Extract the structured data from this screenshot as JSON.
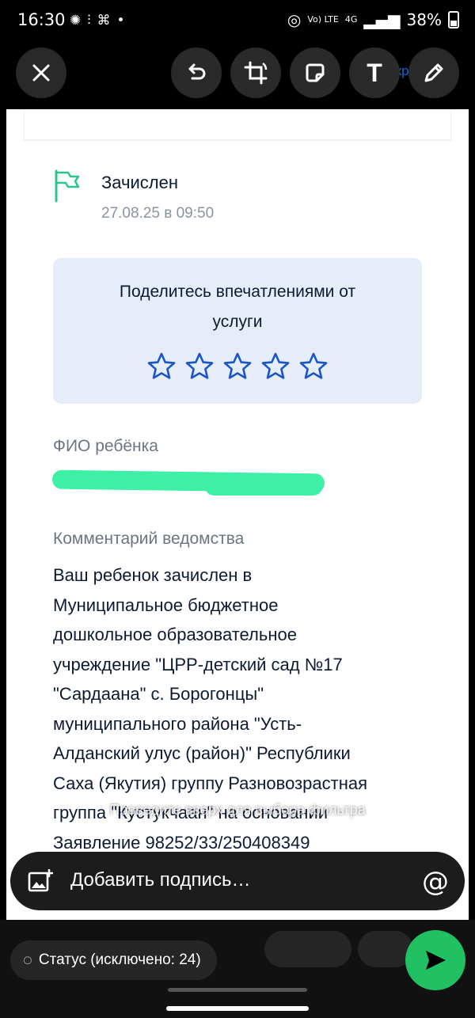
{
  "status_bar": {
    "time": "16:30",
    "notification_icons": [
      "fan-icon",
      "audio-icon",
      "shop-icon",
      "dot-icon"
    ],
    "network_volte": "Vo) LTE",
    "network_4g": "4G",
    "battery": "38%"
  },
  "toolbar": {
    "close": "close-icon",
    "undo": "undo-icon",
    "crop_rotate": "crop-rotate-icon",
    "sticker": "sticker-icon",
    "text_tool": "T",
    "draw": "pencil-icon",
    "behind_link": "Закрыть"
  },
  "screenshot": {
    "status_title": "Зачислен",
    "status_date": "27.08.25 в 09:50",
    "rating_prompt_line1": "Поделитесь впечатлениями от",
    "rating_prompt_line2": "услуги",
    "stars_total": 5,
    "child_name_label": "ФИО ребёнка",
    "comment_label": "Комментарий ведомства",
    "comment_text": "Ваш ребенок зачислен в\nМуниципальное бюджетное\nдошкольное образовательное\nучреждение \"ЦРР-детский сад №17\n\"Сардаана\" с. Борогонцы\"\nмуниципального района \"Усть-\nАлданский улус (район)\" Республики\nСаха (Якутия) группу Разновозрастная\nгруппа \"Кустукчаан\" на основании\nЗаявление 98252/33/250408349"
  },
  "overlay": {
    "swipe_hint": "Проведите вверх для выбора фильтра"
  },
  "caption": {
    "placeholder": "Добавить подпись…",
    "mention": "@"
  },
  "footer": {
    "status_label": "Статус (исключено: 24)"
  },
  "colors": {
    "accent_green": "#21c063",
    "brand_blue": "#1a56c8",
    "rating_bg": "#e6ecf8",
    "redaction": "#3df0a6"
  }
}
